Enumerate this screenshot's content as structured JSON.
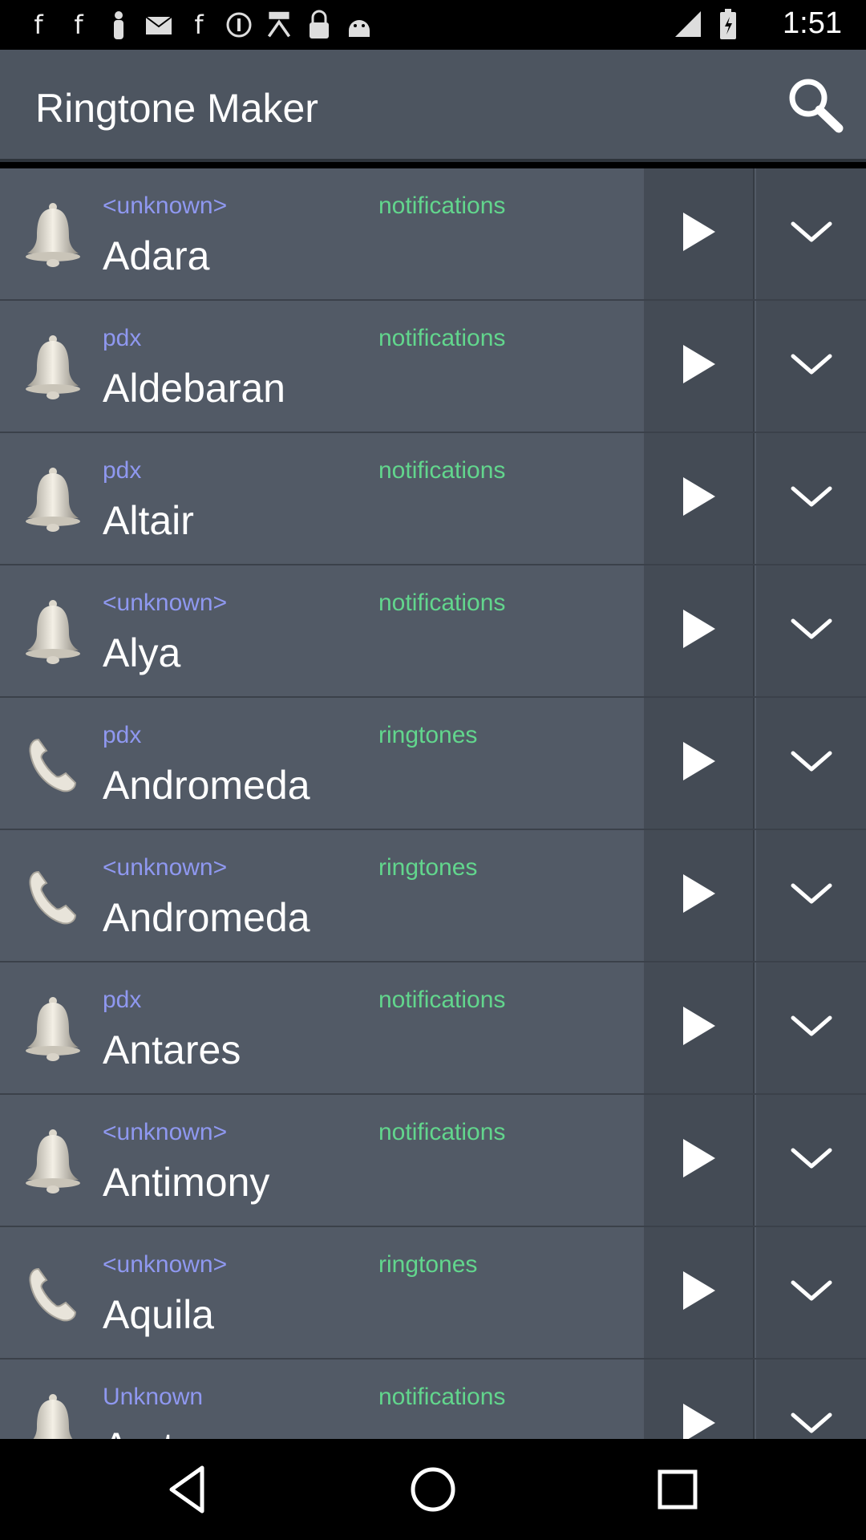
{
  "status_bar": {
    "time": "1:51",
    "left_icons": [
      "facebook-icon",
      "facebook-icon",
      "person-icon",
      "mail-icon",
      "facebook-icon",
      "info-icon",
      "fake-gps-icon",
      "lock-icon",
      "android-icon"
    ],
    "right_icons": [
      "signal-icon",
      "battery-icon"
    ]
  },
  "app_bar": {
    "title": "Ringtone Maker",
    "search_icon": "search-icon"
  },
  "colors": {
    "artist_text": "#8f98f0",
    "category_text": "#62d68d",
    "title_text": "#ffffff",
    "row_bg": "#525a66",
    "button_bg": "#444b55"
  },
  "rows": [
    {
      "icon": "bell-icon",
      "artist": "<unknown>",
      "category": "notifications",
      "title": "Adara"
    },
    {
      "icon": "bell-icon",
      "artist": "pdx",
      "category": "notifications",
      "title": "Aldebaran"
    },
    {
      "icon": "bell-icon",
      "artist": "pdx",
      "category": "notifications",
      "title": "Altair"
    },
    {
      "icon": "bell-icon",
      "artist": "<unknown>",
      "category": "notifications",
      "title": "Alya"
    },
    {
      "icon": "phone-icon",
      "artist": "pdx",
      "category": "ringtones",
      "title": "Andromeda"
    },
    {
      "icon": "phone-icon",
      "artist": "<unknown>",
      "category": "ringtones",
      "title": "Andromeda"
    },
    {
      "icon": "bell-icon",
      "artist": "pdx",
      "category": "notifications",
      "title": "Antares"
    },
    {
      "icon": "bell-icon",
      "artist": "<unknown>",
      "category": "notifications",
      "title": "Antimony"
    },
    {
      "icon": "phone-icon",
      "artist": "<unknown>",
      "category": "ringtones",
      "title": "Aquila"
    },
    {
      "icon": "bell-icon",
      "artist": "Unknown",
      "category": "notifications",
      "title": "Arcturus"
    }
  ]
}
